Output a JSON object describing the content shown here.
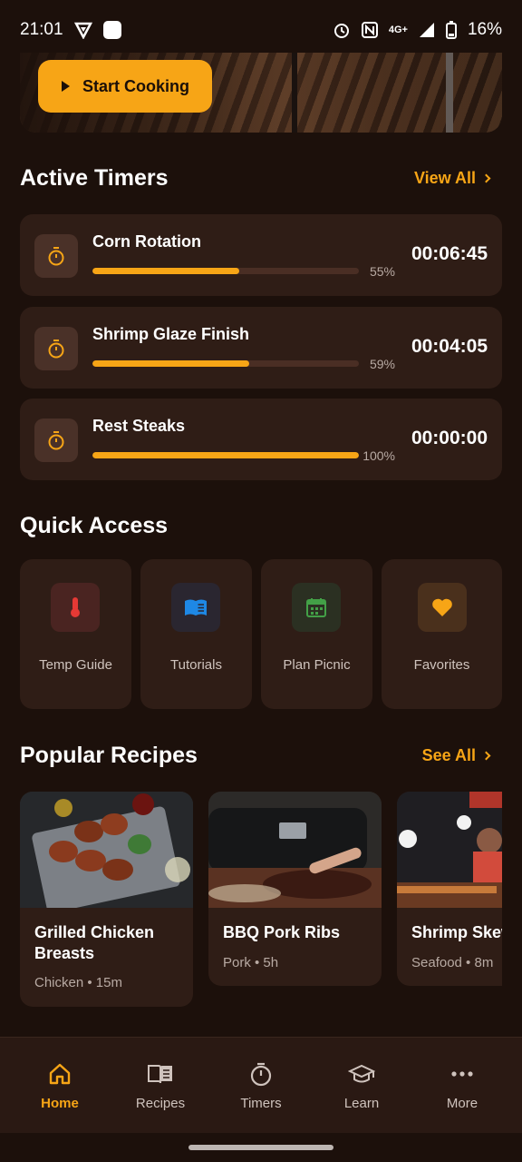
{
  "status_bar": {
    "time": "21:01",
    "network": "4G+",
    "battery": "16%"
  },
  "hero": {
    "button_label": "Start Cooking"
  },
  "active_timers": {
    "title": "Active Timers",
    "view_all": "View All",
    "items": [
      {
        "name": "Corn Rotation",
        "progress_label": "55%",
        "progress": 0.55,
        "time": "00:06:45"
      },
      {
        "name": "Shrimp Glaze Finish",
        "progress_label": "59%",
        "progress": 0.59,
        "time": "00:04:05"
      },
      {
        "name": "Rest Steaks",
        "progress_label": "100%",
        "progress": 1.0,
        "time": "00:00:00"
      }
    ]
  },
  "quick_access": {
    "title": "Quick Access",
    "items": [
      {
        "label": "Temp Guide",
        "icon": "thermometer-icon",
        "color": "#e53935",
        "bg": "#4a2421"
      },
      {
        "label": "Tutorials",
        "icon": "book-icon",
        "color": "#1e88e5",
        "bg": "#2a2630"
      },
      {
        "label": "Plan Picnic",
        "icon": "calendar-icon",
        "color": "#43a047",
        "bg": "#2b3022"
      },
      {
        "label": "Favorites",
        "icon": "heart-icon",
        "color": "#f7a516",
        "bg": "#4a301c"
      }
    ]
  },
  "popular_recipes": {
    "title": "Popular Recipes",
    "see_all": "See All",
    "items": [
      {
        "title": "Grilled Chicken Breasts",
        "meta": "Chicken • 15m"
      },
      {
        "title": "BBQ Pork Ribs",
        "meta": "Pork • 5h"
      },
      {
        "title": "Shrimp Skewers",
        "meta": "Seafood • 8m"
      }
    ]
  },
  "nav": {
    "items": [
      {
        "label": "Home",
        "icon": "home-icon"
      },
      {
        "label": "Recipes",
        "icon": "recipe-book-icon"
      },
      {
        "label": "Timers",
        "icon": "stopwatch-icon"
      },
      {
        "label": "Learn",
        "icon": "graduation-cap-icon"
      },
      {
        "label": "More",
        "icon": "more-dots-icon"
      }
    ],
    "active": "Home"
  },
  "colors": {
    "accent": "#f7a516",
    "background": "#1c100b",
    "card": "#2f1d16"
  }
}
